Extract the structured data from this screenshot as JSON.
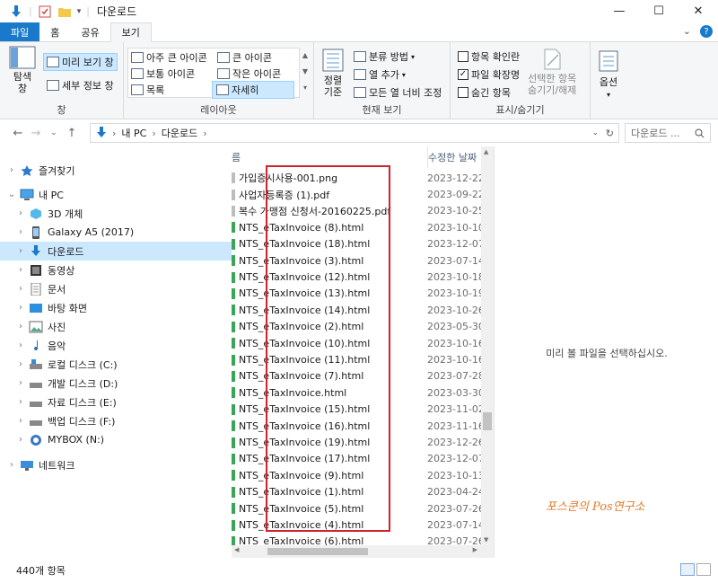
{
  "window": {
    "title": "다운로드",
    "controls": [
      "—",
      "☐",
      "✕"
    ]
  },
  "ribbon": {
    "tabs": [
      "파일",
      "홈",
      "공유",
      "보기"
    ],
    "help": [
      "⌄",
      "?"
    ],
    "groups": {
      "pane": {
        "label": "창",
        "nav_pane": "탐색\n창",
        "preview_pane": "미리 보기 창",
        "details_pane": "세부 정보 창"
      },
      "layout": {
        "label": "레이아웃",
        "items": [
          "아주 큰 아이콘",
          "큰 아이콘",
          "보통 아이콘",
          "작은 아이콘",
          "목록",
          "자세히"
        ]
      },
      "current_view": {
        "label": "현재 보기",
        "sort": "정렬\n기준",
        "group_by": "분류 방법",
        "add_column": "열 추가",
        "fit_columns": "모든 열 너비 조정"
      },
      "show_hide": {
        "label": "표시/숨기기",
        "item_checkbox": "항목 확인란",
        "file_ext": "파일 확장명",
        "hidden_items": "숨긴 항목",
        "hide_selected": "선택한 항목\n숨기기/해제",
        "options": "옵션"
      }
    }
  },
  "address": {
    "path": [
      "내 PC",
      "다운로드"
    ],
    "search_placeholder": "다운로드 ..."
  },
  "nav": {
    "items": [
      {
        "label": "즐겨찾기",
        "icon": "star-icon"
      },
      {
        "label": "내 PC",
        "icon": "pc-icon"
      },
      {
        "label": "3D 개체",
        "icon": "cube-icon"
      },
      {
        "label": "Galaxy A5 (2017)",
        "icon": "phone-icon"
      },
      {
        "label": "다운로드",
        "icon": "download-icon"
      },
      {
        "label": "동영상",
        "icon": "video-icon"
      },
      {
        "label": "문서",
        "icon": "document-icon"
      },
      {
        "label": "바탕 화면",
        "icon": "desktop-icon"
      },
      {
        "label": "사진",
        "icon": "picture-icon"
      },
      {
        "label": "음악",
        "icon": "music-icon"
      },
      {
        "label": "로컬 디스크 (C:)",
        "icon": "drive-icon"
      },
      {
        "label": "개발 디스크 (D:)",
        "icon": "drive-icon"
      },
      {
        "label": "자료 디스크 (E:)",
        "icon": "drive-icon"
      },
      {
        "label": "백업 디스크 (F:)",
        "icon": "drive-icon"
      },
      {
        "label": "MYBOX (N:)",
        "icon": "cloud-drive-icon"
      },
      {
        "label": "네트워크",
        "icon": "network-icon"
      }
    ]
  },
  "list": {
    "columns": [
      "름",
      "수정한 날짜"
    ],
    "rows": [
      {
        "name": "가입증시사용-001.png",
        "date": "2023-12-22"
      },
      {
        "name": "사업자등록증 (1).pdf",
        "date": "2023-09-22"
      },
      {
        "name": "복수 가맹점 신청서-20160225.pdf",
        "date": "2023-10-25"
      },
      {
        "name": "NTS_eTaxInvoice (8).html",
        "date": "2023-10-10"
      },
      {
        "name": "NTS_eTaxInvoice (18).html",
        "date": "2023-12-07"
      },
      {
        "name": "NTS_eTaxInvoice (3).html",
        "date": "2023-07-14"
      },
      {
        "name": "NTS_eTaxInvoice (12).html",
        "date": "2023-10-18"
      },
      {
        "name": "NTS_eTaxInvoice (13).html",
        "date": "2023-10-19"
      },
      {
        "name": "NTS_eTaxInvoice (14).html",
        "date": "2023-10-26"
      },
      {
        "name": "NTS_eTaxInvoice (2).html",
        "date": "2023-05-30"
      },
      {
        "name": "NTS_eTaxInvoice (10).html",
        "date": "2023-10-16"
      },
      {
        "name": "NTS_eTaxInvoice (11).html",
        "date": "2023-10-16"
      },
      {
        "name": "NTS_eTaxInvoice (7).html",
        "date": "2023-07-28"
      },
      {
        "name": "NTS_eTaxInvoice.html",
        "date": "2023-03-30"
      },
      {
        "name": "NTS_eTaxInvoice (15).html",
        "date": "2023-11-02"
      },
      {
        "name": "NTS_eTaxInvoice (16).html",
        "date": "2023-11-16"
      },
      {
        "name": "NTS_eTaxInvoice (19).html",
        "date": "2023-12-26"
      },
      {
        "name": "NTS_eTaxInvoice (17).html",
        "date": "2023-12-07"
      },
      {
        "name": "NTS_eTaxInvoice (9).html",
        "date": "2023-10-13"
      },
      {
        "name": "NTS_eTaxInvoice (1).html",
        "date": "2023-04-24"
      },
      {
        "name": "NTS_eTaxInvoice (5).html",
        "date": "2023-07-26"
      },
      {
        "name": "NTS_eTaxInvoice (4).html",
        "date": "2023-07-14"
      },
      {
        "name": "NTS_eTaxInvoice (6).html",
        "date": "2023-07-26"
      }
    ]
  },
  "preview": {
    "empty_text": "미리 볼 파일을 선택하십시오.",
    "watermark": "포스쿤의 Pos연구소"
  },
  "status": {
    "count": "440개 항목"
  },
  "colors": {
    "accent": "#1979ca",
    "selection": "#cce8ff",
    "highlight_box": "#d0222c",
    "html_icon": "#3aa655"
  }
}
